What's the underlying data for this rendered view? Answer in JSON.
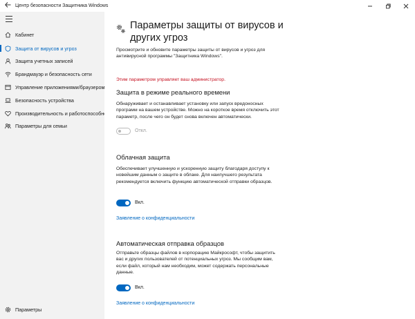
{
  "window": {
    "title": "Центр безопасности Защитника Windows",
    "back_icon": "back-arrow-icon",
    "controls": [
      "minimize-icon",
      "maximize-icon",
      "close-icon"
    ]
  },
  "sidebar": {
    "items": [
      {
        "label": "Кабинет",
        "icon": "home-icon"
      },
      {
        "label": "Защита от вирусов и угроз",
        "icon": "shield-icon",
        "active": true
      },
      {
        "label": "Защита учетных записей",
        "icon": "person-icon"
      },
      {
        "label": "Брандмауэр и безопасность сети",
        "icon": "wifi-icon"
      },
      {
        "label": "Управление приложениями/браузером",
        "icon": "app-browser-icon"
      },
      {
        "label": "Безопасность устройства",
        "icon": "laptop-icon"
      },
      {
        "label": "Производительность и работоспособнос",
        "icon": "heart-icon"
      },
      {
        "label": "Параметры для семьи",
        "icon": "family-icon"
      }
    ],
    "settings_label": "Параметры"
  },
  "main": {
    "title": "Параметры защиты от вирусов и других угроз",
    "intro": "Просмотрите и обновите параметры защиты от вирусов и угроз для антивирусной программы \"Защитника Windows\".",
    "admin_notice": "Этим параметром управляет ваш администратор.",
    "sections": [
      {
        "title": "Защита в режиме реального времени",
        "description": "Обнаруживает и останавливает установку или запуск вредоносных программ на вашем устройстве. Можно на короткое время отключить этот параметр, после чего он будет снова включен автоматически.",
        "toggle_label": "Откл."
      },
      {
        "title": "Облачная защита",
        "description": "Обеспечивает улучшенную и ускоренную защиту благодаря доступу к новейшим данным о защите в облаке. Для наилучшего результата рекомендуется включить функцию автоматической отправки образцов.",
        "toggle_label": "Вкл.",
        "link": "Заявление о конфиденциальности"
      },
      {
        "title": "Автоматическая отправка образцов",
        "description": "Отправьте образцы файлов в корпорацию Майкрософт, чтобы защитить вас и других пользователей от потенциальных угроз. Мы сообщим вам, если файл, который нам необходим, может содержать персональные данные.",
        "toggle_label": "Вкл.",
        "link": "Заявление о конфиденциальности"
      }
    ]
  },
  "colors": {
    "accent": "#0067c0",
    "admin_notice": "#c50f1f",
    "sidebar_bg": "#f2f2f2"
  }
}
